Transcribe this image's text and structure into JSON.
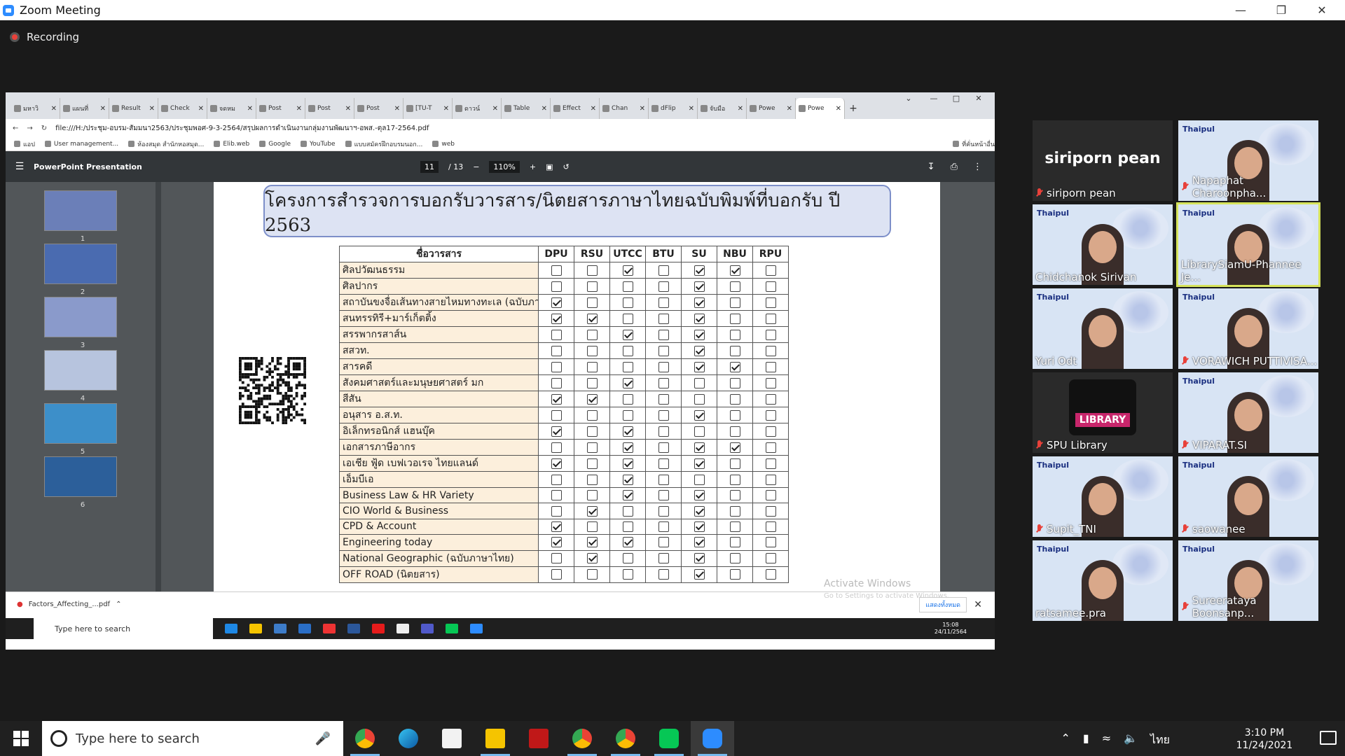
{
  "window": {
    "title": "Zoom Meeting",
    "recording_label": "Recording"
  },
  "browser": {
    "tabs": [
      "มหาวิ",
      "แผนที่",
      "Result",
      "Check",
      "จดหม",
      "Post",
      "Post",
      "Post",
      "[TU-T",
      "ดาวน์",
      "Table",
      "Effect",
      "Chan",
      "dFlip",
      "จับมือ",
      "Powe",
      "Powe"
    ],
    "url": "file:///H:/ประชุม-อบรม-สัมมนา2563/ประชุมพอศ-9-3-2564/สรุปผลการดำเนินงานกลุ่มงานพัฒนาฯ-อพส.-ตุล17-2564.pdf",
    "bookmarks": [
      "แอป",
      "User management...",
      "ห้องสมุด สำนักหอสมุด...",
      "Elib.web",
      "Google",
      "YouTube",
      "แบบสมัครฝึกอบรมนอก...",
      "web",
      "ที่คั่นหน้าอื่น"
    ]
  },
  "pdf": {
    "doc_title": "PowerPoint Presentation",
    "page_current": "11",
    "page_total": "/ 13",
    "zoom": "110%",
    "thumb_labels": [
      "1",
      "2",
      "3",
      "4",
      "5",
      "6"
    ],
    "slide_title": "โครงการสำรวจการบอกรับวารสาร/นิตยสารภาษาไทยฉบับพิมพ์ที่บอกรับ ปี 2563",
    "table": {
      "name_header": "ชื่อวารสาร",
      "columns": [
        "DPU",
        "RSU",
        "UTCC",
        "BTU",
        "SU",
        "NBU",
        "RPU"
      ],
      "rows": [
        {
          "name": "ศิลปวัฒนธรรม",
          "checks": [
            0,
            0,
            1,
            0,
            1,
            1,
            0
          ]
        },
        {
          "name": "ศิลปากร",
          "checks": [
            0,
            0,
            0,
            0,
            1,
            0,
            0
          ]
        },
        {
          "name": "สถาบันขงจื่อเส้นทางสายไหมทางทะเล (ฉบับภาษาไทย)",
          "checks": [
            1,
            0,
            0,
            0,
            1,
            0,
            0
          ]
        },
        {
          "name": "สนทรรทิรี+มาร์เก็ตติ้ง",
          "checks": [
            1,
            1,
            0,
            0,
            1,
            0,
            0
          ]
        },
        {
          "name": "สรรพากรสาส์น",
          "checks": [
            0,
            0,
            1,
            0,
            1,
            0,
            0
          ]
        },
        {
          "name": "สสวท.",
          "checks": [
            0,
            0,
            0,
            0,
            1,
            0,
            0
          ]
        },
        {
          "name": "สารคดี",
          "checks": [
            0,
            0,
            0,
            0,
            1,
            1,
            0
          ]
        },
        {
          "name": "สังคมศาสตร์และมนุษยศาสตร์ มก",
          "checks": [
            0,
            0,
            1,
            0,
            0,
            0,
            0
          ]
        },
        {
          "name": "สีสัน",
          "checks": [
            1,
            1,
            0,
            0,
            0,
            0,
            0
          ]
        },
        {
          "name": "อนุสาร อ.ส.ท.",
          "checks": [
            0,
            0,
            0,
            0,
            1,
            0,
            0
          ]
        },
        {
          "name": "อิเล็กทรอนิกส์ แฮนบุ๊ค",
          "checks": [
            1,
            0,
            1,
            0,
            0,
            0,
            0
          ]
        },
        {
          "name": "เอกสารภาษีอากร",
          "checks": [
            0,
            0,
            1,
            0,
            1,
            1,
            0
          ]
        },
        {
          "name": "เอเชีย ฟู้ด เบฟเวอเรจ ไทยแลนด์",
          "checks": [
            1,
            0,
            1,
            0,
            1,
            0,
            0
          ]
        },
        {
          "name": "เอ็มบีเอ",
          "checks": [
            0,
            0,
            1,
            0,
            0,
            0,
            0
          ]
        },
        {
          "name": "Business Law & HR Variety",
          "checks": [
            0,
            0,
            1,
            0,
            1,
            0,
            0
          ]
        },
        {
          "name": "CIO World & Business",
          "checks": [
            0,
            1,
            0,
            0,
            1,
            0,
            0
          ]
        },
        {
          "name": "CPD & Account",
          "checks": [
            1,
            0,
            0,
            0,
            1,
            0,
            0
          ]
        },
        {
          "name": "Engineering today",
          "checks": [
            1,
            1,
            1,
            0,
            1,
            0,
            0
          ]
        },
        {
          "name": "National Geographic (ฉบับภาษาไทย)",
          "checks": [
            0,
            1,
            0,
            0,
            1,
            0,
            0
          ]
        },
        {
          "name": "OFF ROAD (นิตยสาร)",
          "checks": [
            0,
            0,
            0,
            0,
            1,
            0,
            0
          ]
        }
      ]
    },
    "watermark_1": "Activate Windows",
    "watermark_2": "Go to Settings to activate Windows."
  },
  "download": {
    "file": "Factors_Affecting_...pdf",
    "show_all": "แสดงทั้งหมด"
  },
  "inner_taskbar": {
    "search": "Type here to search",
    "time": "15:08",
    "date": "24/11/2564"
  },
  "participants": [
    {
      "name": "siriporn pean",
      "muted": true,
      "video": false
    },
    {
      "name": "Napaphat Charoonpha...",
      "muted": true,
      "video": true
    },
    {
      "name": "Chidchanok Sirivan",
      "muted": false,
      "video": true
    },
    {
      "name": "LibrarySiamU-Phannee Je...",
      "muted": false,
      "video": true
    },
    {
      "name": "Yuri Odt",
      "muted": false,
      "video": true
    },
    {
      "name": "VORAWICH PUTTIVISA...",
      "muted": true,
      "video": true
    },
    {
      "name": "SPU Library",
      "muted": true,
      "video": false
    },
    {
      "name": "VIPARAT.SI",
      "muted": true,
      "video": true
    },
    {
      "name": "Supit_TNI",
      "muted": true,
      "video": true
    },
    {
      "name": "saowanee",
      "muted": true,
      "video": true
    },
    {
      "name": "ratsamee.pra",
      "muted": false,
      "video": true
    },
    {
      "name": "Sureerataya Boonsanp...",
      "muted": true,
      "video": true
    }
  ],
  "thaipul_badge": "Thaipul",
  "library_logo": "LIBRARY",
  "taskbar": {
    "search": "Type here to search",
    "time": "3:10 PM",
    "date": "11/24/2021",
    "lang": "ไทย"
  },
  "colors": {
    "zoom_blue": "#2d8cff",
    "rec_red": "#e8413a",
    "active_speaker": "#d6e35a"
  }
}
